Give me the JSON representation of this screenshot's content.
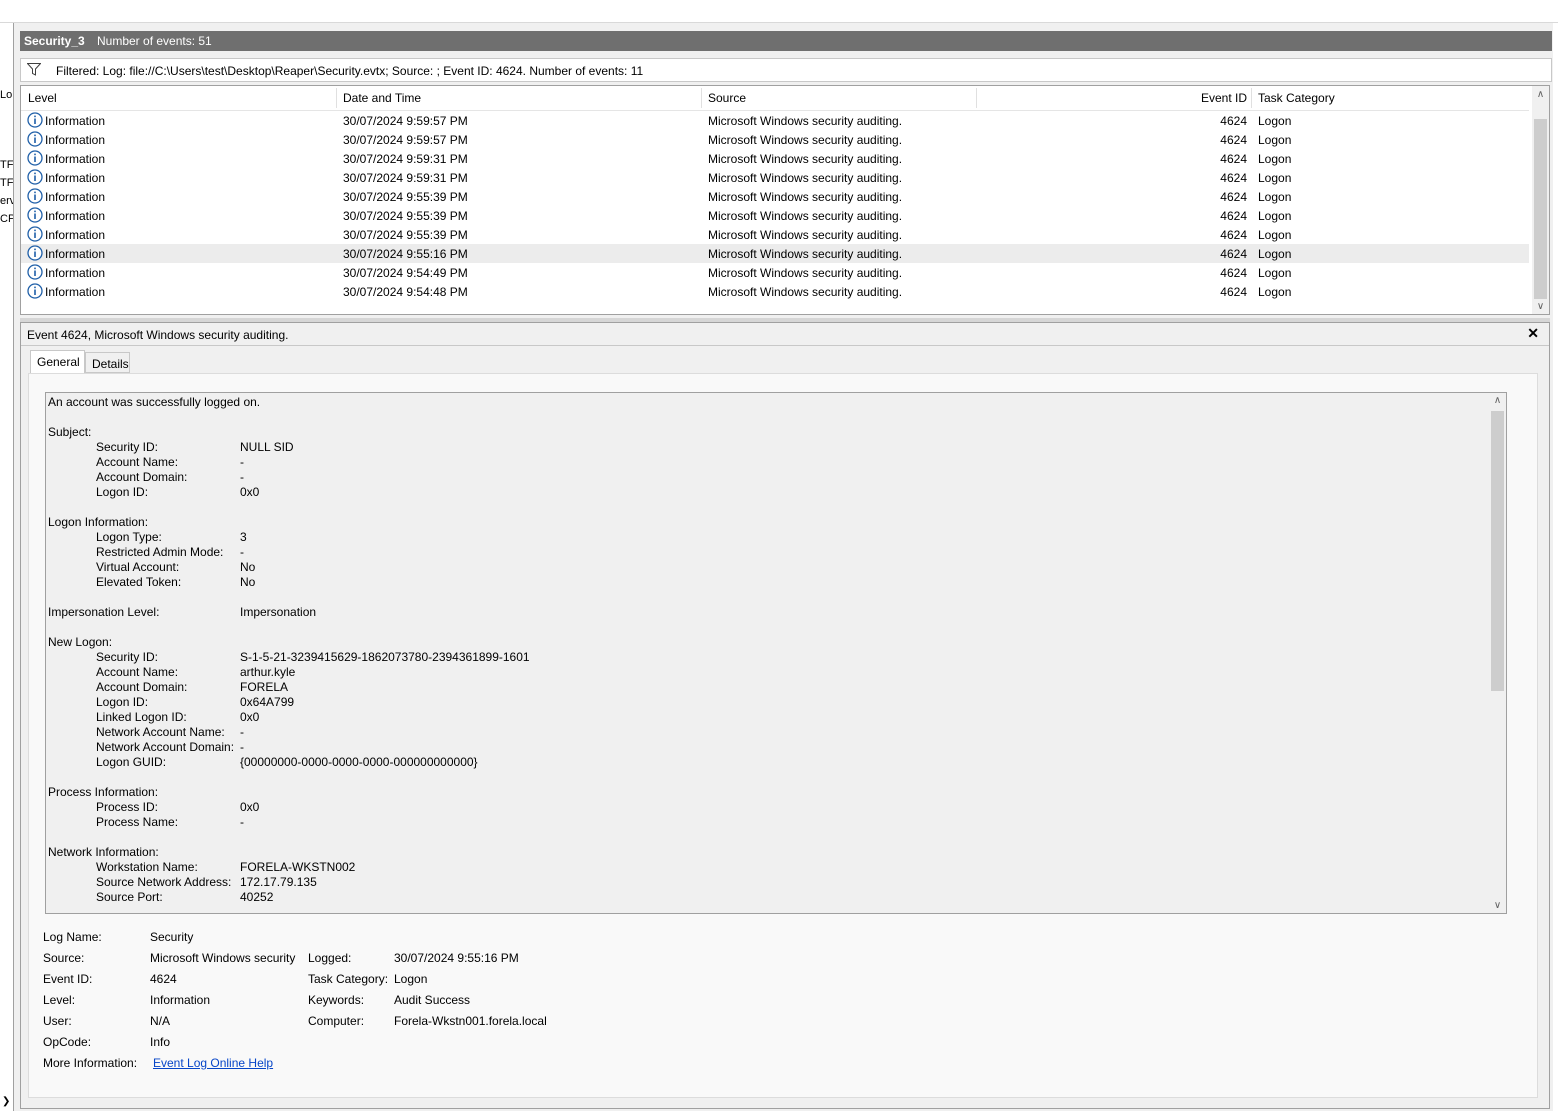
{
  "left_strip": [
    "Lo",
    "TF",
    "TF",
    "erv",
    "CP"
  ],
  "header": {
    "log_name": "Security_3",
    "event_count": "Number of events: 51"
  },
  "filter": {
    "text": "Filtered: Log: file://C:\\Users\\test\\Desktop\\Reaper\\Security.evtx; Source: ; Event ID: 4624. Number of events: 11"
  },
  "table": {
    "columns": [
      "Level",
      "Date and Time",
      "Source",
      "Event ID",
      "Task Category"
    ],
    "rows": [
      {
        "level": "Information",
        "datetime": "30/07/2024 9:59:57 PM",
        "source": "Microsoft Windows security auditing.",
        "event_id": "4624",
        "task": "Logon"
      },
      {
        "level": "Information",
        "datetime": "30/07/2024 9:59:57 PM",
        "source": "Microsoft Windows security auditing.",
        "event_id": "4624",
        "task": "Logon"
      },
      {
        "level": "Information",
        "datetime": "30/07/2024 9:59:31 PM",
        "source": "Microsoft Windows security auditing.",
        "event_id": "4624",
        "task": "Logon"
      },
      {
        "level": "Information",
        "datetime": "30/07/2024 9:59:31 PM",
        "source": "Microsoft Windows security auditing.",
        "event_id": "4624",
        "task": "Logon"
      },
      {
        "level": "Information",
        "datetime": "30/07/2024 9:55:39 PM",
        "source": "Microsoft Windows security auditing.",
        "event_id": "4624",
        "task": "Logon"
      },
      {
        "level": "Information",
        "datetime": "30/07/2024 9:55:39 PM",
        "source": "Microsoft Windows security auditing.",
        "event_id": "4624",
        "task": "Logon"
      },
      {
        "level": "Information",
        "datetime": "30/07/2024 9:55:39 PM",
        "source": "Microsoft Windows security auditing.",
        "event_id": "4624",
        "task": "Logon"
      },
      {
        "level": "Information",
        "datetime": "30/07/2024 9:55:16 PM",
        "source": "Microsoft Windows security auditing.",
        "event_id": "4624",
        "task": "Logon"
      },
      {
        "level": "Information",
        "datetime": "30/07/2024 9:54:49 PM",
        "source": "Microsoft Windows security auditing.",
        "event_id": "4624",
        "task": "Logon"
      },
      {
        "level": "Information",
        "datetime": "30/07/2024 9:54:48 PM",
        "source": "Microsoft Windows security auditing.",
        "event_id": "4624",
        "task": "Logon"
      }
    ]
  },
  "detail": {
    "title": "Event 4624, Microsoft Windows security auditing.",
    "tabs": [
      "General",
      "Details"
    ],
    "description_lines": [
      {
        "label": "An account was successfully logged on.",
        "value": ""
      },
      {
        "label": "",
        "value": ""
      },
      {
        "label": "Subject:",
        "value": ""
      },
      {
        "label": "Security ID:",
        "value": "NULL SID",
        "indent": true
      },
      {
        "label": "Account Name:",
        "value": "-",
        "indent": true
      },
      {
        "label": "Account Domain:",
        "value": "-",
        "indent": true
      },
      {
        "label": "Logon ID:",
        "value": "0x0",
        "indent": true
      },
      {
        "label": "",
        "value": ""
      },
      {
        "label": "Logon Information:",
        "value": ""
      },
      {
        "label": "Logon Type:",
        "value": "3",
        "indent": true
      },
      {
        "label": "Restricted Admin Mode:",
        "value": "-",
        "indent": true
      },
      {
        "label": "Virtual Account:",
        "value": "No",
        "indent": true
      },
      {
        "label": "Elevated Token:",
        "value": "No",
        "indent": true
      },
      {
        "label": "",
        "value": ""
      },
      {
        "label": "Impersonation Level:",
        "value": "Impersonation"
      },
      {
        "label": "",
        "value": ""
      },
      {
        "label": "New Logon:",
        "value": ""
      },
      {
        "label": "Security ID:",
        "value": "S-1-5-21-3239415629-1862073780-2394361899-1601",
        "indent": true
      },
      {
        "label": "Account Name:",
        "value": "arthur.kyle",
        "indent": true
      },
      {
        "label": "Account Domain:",
        "value": "FORELA",
        "indent": true
      },
      {
        "label": "Logon ID:",
        "value": "0x64A799",
        "indent": true
      },
      {
        "label": "Linked Logon ID:",
        "value": "0x0",
        "indent": true
      },
      {
        "label": "Network Account Name:",
        "value": "-",
        "indent": true
      },
      {
        "label": "Network Account Domain:",
        "value": "-",
        "indent": true
      },
      {
        "label": "Logon GUID:",
        "value": "{00000000-0000-0000-0000-000000000000}",
        "indent": true
      },
      {
        "label": "",
        "value": ""
      },
      {
        "label": "Process Information:",
        "value": ""
      },
      {
        "label": "Process ID:",
        "value": "0x0",
        "indent": true
      },
      {
        "label": "Process Name:",
        "value": "-",
        "indent": true
      },
      {
        "label": "",
        "value": ""
      },
      {
        "label": "Network Information:",
        "value": ""
      },
      {
        "label": "Workstation Name:",
        "value": "FORELA-WKSTN002",
        "indent": true
      },
      {
        "label": "Source Network Address:",
        "value": "172.17.79.135",
        "indent": true
      },
      {
        "label": "Source Port:",
        "value": "40252",
        "indent": true
      }
    ],
    "properties": {
      "log_name_label": "Log Name:",
      "log_name": "Security",
      "source_label": "Source:",
      "source": "Microsoft Windows security",
      "logged_label": "Logged:",
      "logged": "30/07/2024 9:55:16 PM",
      "event_id_label": "Event ID:",
      "event_id": "4624",
      "task_category_label": "Task Category:",
      "task_category": "Logon",
      "level_label": "Level:",
      "level": "Information",
      "keywords_label": "Keywords:",
      "keywords": "Audit Success",
      "user_label": "User:",
      "user": "N/A",
      "computer_label": "Computer:",
      "computer": "Forela-Wkstn001.forela.local",
      "opcode_label": "OpCode:",
      "opcode": "Info",
      "more_info_label": "More Information:",
      "more_info_link": "Event Log Online Help"
    }
  },
  "colors": {
    "titlebar": "#6f6f6f",
    "selected_row": "#ececec",
    "info_icon": "#1f5fa8",
    "link": "#0645c8"
  }
}
